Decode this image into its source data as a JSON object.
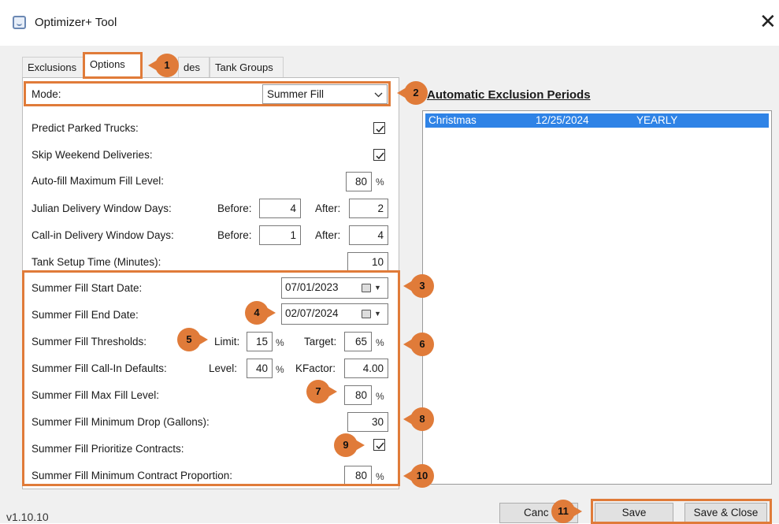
{
  "window": {
    "title": "Optimizer+ Tool",
    "close_glyph": "✕"
  },
  "tabs": [
    {
      "label": "Exclusions"
    },
    {
      "label": "Options"
    },
    {
      "label": "des"
    },
    {
      "label": "Tank Groups"
    }
  ],
  "mode": {
    "label": "Mode:",
    "value": "Summer Fill"
  },
  "options": {
    "predict_parked": {
      "label": "Predict Parked Trucks:",
      "checked": true
    },
    "skip_weekend": {
      "label": "Skip Weekend Deliveries:",
      "checked": true
    },
    "autofill_max": {
      "label": "Auto-fill Maximum Fill Level:",
      "value": "80",
      "unit": "%"
    },
    "julian_window": {
      "label": "Julian Delivery Window Days:",
      "before_label": "Before:",
      "before": "4",
      "after_label": "After:",
      "after": "2"
    },
    "callin_window": {
      "label": "Call-in Delivery Window Days:",
      "before_label": "Before:",
      "before": "1",
      "after_label": "After:",
      "after": "4"
    },
    "tank_setup": {
      "label": "Tank Setup Time (Minutes):",
      "value": "10"
    }
  },
  "summer": {
    "start": {
      "label": "Summer Fill Start Date:",
      "value": "07/01/2023"
    },
    "end": {
      "label": "Summer Fill End Date:",
      "value": "02/07/2024"
    },
    "thresholds": {
      "label": "Summer Fill Thresholds:",
      "limit_label": "Limit:",
      "limit": "15",
      "target_label": "Target:",
      "target": "65",
      "unit": "%"
    },
    "callin_defaults": {
      "label": "Summer Fill Call-In Defaults:",
      "level_label": "Level:",
      "level": "40",
      "kfactor_label": "KFactor:",
      "kfactor": "4.00",
      "unit": "%"
    },
    "max_fill": {
      "label": "Summer Fill Max Fill Level:",
      "value": "80",
      "unit": "%"
    },
    "min_drop": {
      "label": "Summer Fill Minimum Drop (Gallons):",
      "value": "30"
    },
    "prioritize": {
      "label": "Summer Fill Prioritize Contracts:",
      "checked": true
    },
    "min_contract": {
      "label": "Summer Fill Minimum Contract Proportion:",
      "value": "80",
      "unit": "%"
    }
  },
  "exclusion_periods": {
    "title": "Automatic Exclusion Periods",
    "rows": [
      {
        "name": "Christmas",
        "date": "12/25/2024",
        "recurrence": "YEARLY"
      }
    ]
  },
  "buttons": {
    "cancel": "Canc",
    "save": "Save",
    "save_close": "Save & Close"
  },
  "version": "v1.10.10",
  "markers": [
    "1",
    "2",
    "3",
    "4",
    "5",
    "6",
    "7",
    "8",
    "9",
    "10",
    "11"
  ],
  "colors": {
    "highlight": "#e07b39",
    "selection": "#2f83e6"
  }
}
